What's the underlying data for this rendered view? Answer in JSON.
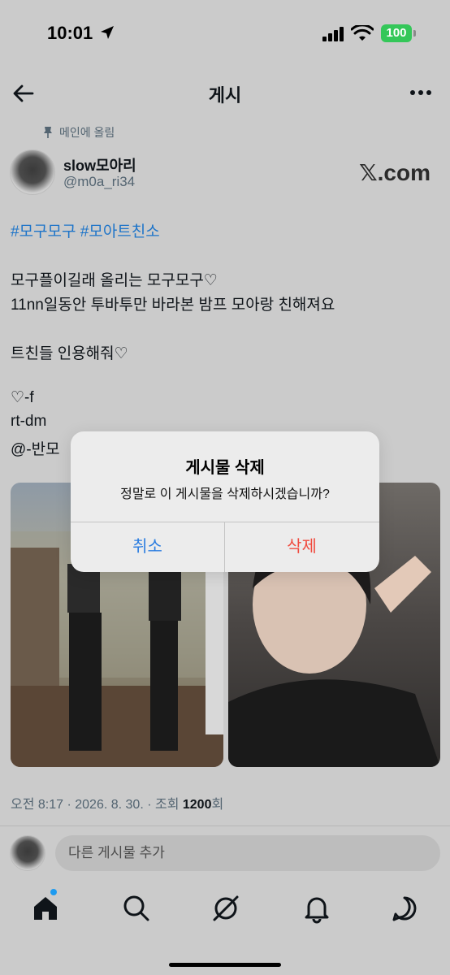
{
  "status": {
    "time": "10:01",
    "battery": "100"
  },
  "nav": {
    "title": "게시"
  },
  "post": {
    "pinned_label": "메인에 올림",
    "display_name": "slow모아리",
    "handle": "@m0a_ri34",
    "source": "𝕏.com",
    "hashtags": "#모구모구 #모아트친소",
    "lines": [
      "모구플이길래 올리는 모구모구♡",
      "11nn일동안 투바투만 바라본 밤프 모아랑 친해져요",
      "트친들 인용해줘♡",
      "♡-f",
      "rt-dm",
      "@-반모"
    ],
    "meta_prefix": "오전 8:17 · 2026. 8. 30. · 조회 ",
    "views": "1200",
    "views_suffix": "회"
  },
  "reply": {
    "placeholder": "다른 게시물 추가"
  },
  "dialog": {
    "title": "게시물 삭제",
    "message": "정말로 이 게시물을 삭제하시겠습니까?",
    "cancel": "취소",
    "delete": "삭제"
  },
  "colors": {
    "link": "#1d74c9",
    "cancel": "#2b7de0",
    "delete": "#f04a3e",
    "battery": "#34c759"
  }
}
